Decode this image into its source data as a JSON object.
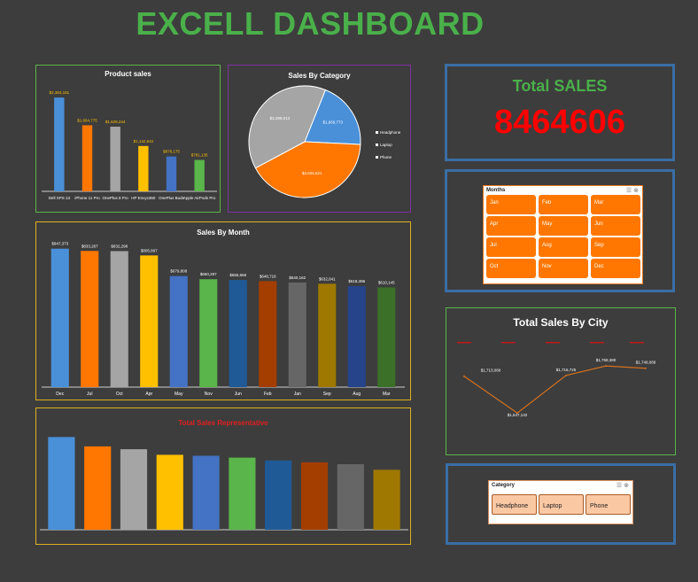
{
  "header": {
    "title": "EXCELL DASHBOARD"
  },
  "colors": {
    "background": "#3d3d3d",
    "title": "#4ab04a",
    "kpi_value": "#ff0000",
    "slicer_button": "#ff7700"
  },
  "kpi": {
    "label": "Total SALES",
    "value": "8464606"
  },
  "months_slicer": {
    "title": "Months",
    "items": [
      "Jan",
      "Feb",
      "Mar",
      "Apr",
      "May",
      "Jun",
      "Jul",
      "Aug",
      "Sep",
      "Oct",
      "Nov",
      "Dec"
    ]
  },
  "category_slicer": {
    "title": "Category",
    "items": [
      "Headphone",
      "Laptop",
      "Phone"
    ]
  },
  "chart_data": [
    {
      "id": "product",
      "type": "bar",
      "title": "Product sales",
      "categories": [
        "Dell XPS 13",
        "iPhone 11 Pro",
        "OnePlus 8 Pro",
        "HP Envyx360",
        "OnePlus Buds",
        "Apple AirPods Pro"
      ],
      "values": [
        2363181,
        1664775,
        1629244,
        1142642,
        878175,
        791135
      ],
      "labels": [
        "$2,363,181",
        "$1,664,775",
        "$1,629,244",
        "$1,142,642",
        "$878,175",
        "$791,135"
      ],
      "colors": [
        "#4a90d9",
        "#ff7700",
        "#a5a5a5",
        "#ffc000",
        "#4472c4",
        "#5ab54a"
      ],
      "ylim": [
        0,
        2500000
      ]
    },
    {
      "id": "category",
      "type": "pie",
      "title": "Sales By Category",
      "categories": [
        "Headphone",
        "Laptop",
        "Phone"
      ],
      "values": [
        1669773,
        3505821,
        3289013
      ],
      "labels": [
        "$1,669,773",
        "$3,505,821",
        "$3,289,013"
      ],
      "colors": [
        "#4a90d9",
        "#ff7700",
        "#a5a5a5"
      ],
      "legend": "right"
    },
    {
      "id": "month",
      "type": "bar",
      "title": "Sales By Month",
      "categories": [
        "Dec",
        "Jul",
        "Oct",
        "Apr",
        "May",
        "Nov",
        "Jun",
        "Feb",
        "Jan",
        "Sep",
        "Aug",
        "Mar"
      ],
      "values": [
        847373,
        833267,
        832298,
        805897,
        679808,
        660297,
        655666,
        648716,
        640162,
        632641,
        618496,
        610145
      ],
      "labels": [
        "$847,373",
        "$833,267",
        "$832,298",
        "$805,897",
        "$679,808",
        "$660,297",
        "$655,666",
        "$648,716",
        "$640,162",
        "$632,641",
        "$618,496",
        "$610,145"
      ],
      "colors": [
        "#4a90d9",
        "#ff7700",
        "#a5a5a5",
        "#ffc000",
        "#4472c4",
        "#5ab54a",
        "#1f5a96",
        "#a33e00",
        "#666666",
        "#9e7800",
        "#26448a",
        "#3b7029"
      ],
      "ylim": [
        0,
        900000
      ]
    },
    {
      "id": "city",
      "type": "line",
      "title": "Total Sales By City",
      "categories": [
        "",
        "",
        "",
        "",
        "",
        ""
      ],
      "values": [
        1713080,
        1547132,
        1716725,
        1759380,
        1749089,
        1749089
      ],
      "labels": [
        "$1,713,080",
        "$1,547,132",
        "$1,716,725",
        "$1,759,380",
        "$1,749,089",
        ""
      ],
      "colors": [
        "#d4701e"
      ]
    },
    {
      "id": "rep",
      "type": "bar",
      "title": "Total Sales Representative",
      "categories": [
        "",
        "",
        "",
        "",
        "",
        "",
        "",
        "",
        "",
        ""
      ],
      "values": [
        990000,
        890000,
        860000,
        800000,
        790000,
        770000,
        740000,
        720000,
        700000,
        640000
      ],
      "colors": [
        "#4a90d9",
        "#ff7700",
        "#a5a5a5",
        "#ffc000",
        "#4472c4",
        "#5ab54a",
        "#1f5a96",
        "#a33e00",
        "#666666",
        "#9e7800"
      ],
      "ylim": [
        0,
        1050000
      ]
    }
  ]
}
